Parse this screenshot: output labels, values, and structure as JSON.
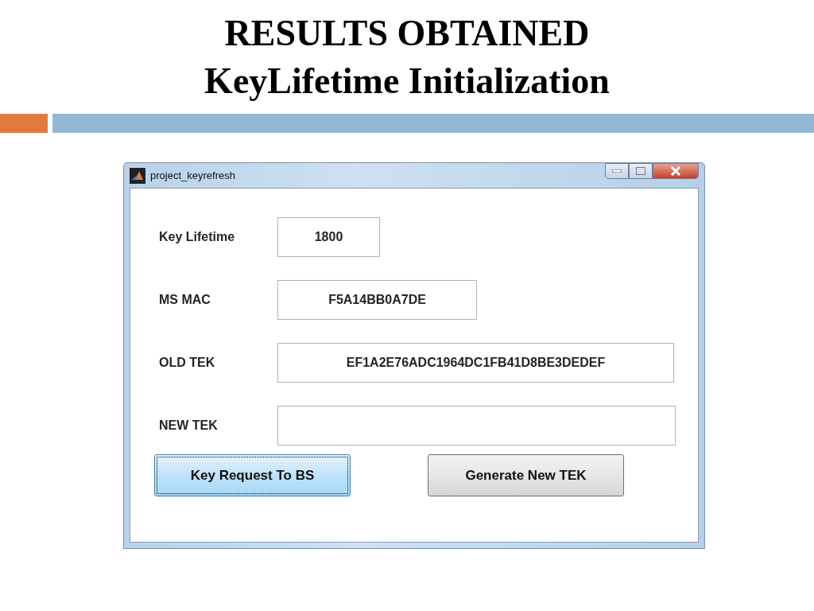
{
  "slide": {
    "title_lines": [
      "RESULTS OBTAINED",
      "KeyLifetime Initialization"
    ]
  },
  "window": {
    "title": "project_keyrefresh"
  },
  "fields": [
    {
      "label": "Key Lifetime",
      "value": "1800"
    },
    {
      "label": "MS MAC",
      "value": "F5A14BB0A7DE"
    },
    {
      "label": "OLD TEK",
      "value": "EF1A2E76ADC1964DC1FB41D8BE3DEDEF"
    },
    {
      "label": "NEW TEK"
    }
  ],
  "buttons": [
    {
      "label": "Key Request To BS",
      "focused": true
    },
    {
      "label": "Generate New TEK",
      "focused": false
    }
  ]
}
